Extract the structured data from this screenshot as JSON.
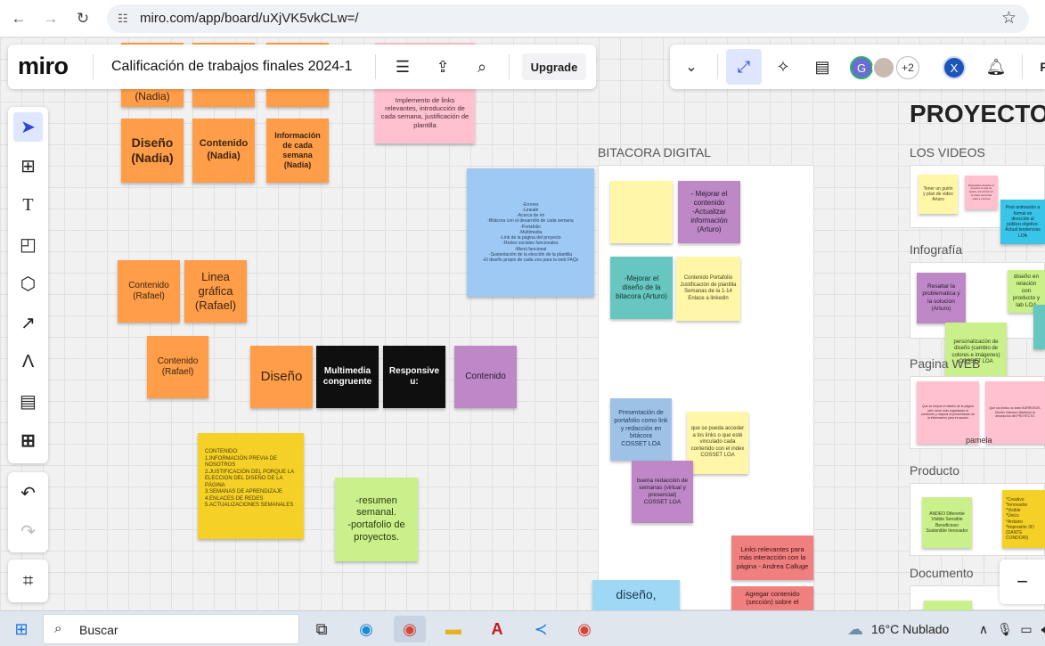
{
  "browser": {
    "url": "miro.com/app/board/uXjVK5vkCLw=/"
  },
  "app": {
    "logo": "miro",
    "board_title": "Calificación de trabajos finales 2024-1",
    "upgrade_label": "Upgrade",
    "collaborators": {
      "g_initial": "G",
      "more_count": "+2",
      "x_initial": "X"
    },
    "right_edge_text": "P"
  },
  "frames": {
    "bitacora_label": "BITACORA DIGITAL",
    "proyecto_title": "PROYECTO",
    "los_videos": "LOS VIDEOS",
    "infografia": "Infografía",
    "pagina_web": "Pagina WEB",
    "producto": "Producto",
    "documento": "Documento"
  },
  "notes": {
    "top_partial": "(Nadia)",
    "pink_top": "Implemento de links relevantes, introducción de cada semana, justificación de plantilla",
    "diseno_nadia": "Diseño (Nadia)",
    "contenido_nadia": "Contenido (Nadia)",
    "info_semana_nadia": "Información de cada semana (Nadia)",
    "blue_big": "-Errores\n-Linealtr\n-Acerca de mi\n-Bitácora con el desarrollo de cada semana\n-Portafolio\n-Multimedia\n-Link de la página del proyecto\n-Redes sociales funcionales\n-Menú funcional\n-Sustentación de la elección de la plantilla\n-El diseño propio de cada uno para la web FAQs",
    "contenido_rafael_1": "Contenido (Rafael)",
    "linea_grafica_rafael": "Linea gráfica (Rafael)",
    "contenido_rafael_2": "Contenido (Rafael)",
    "diseno": "Diseño",
    "multimedia": "Multimedia congruente",
    "responsive": "Responsive u:",
    "contenido": "Contenido",
    "yellow_contenido": "CONTENIDO:\n1.INFORMACIÓN PREVIA DE NOSOTROS\n2.JUSTIFICACIÓN DEL PORQUE LA ELECCION DEL DISEÑO DE LA PÁGINA\n3.SEMANAS DE APRENDIZAJE\n4.ENLACES DE REDES\n5.ACTUALIZACIONES SEMANALES",
    "resumen": "-resumen semanal.\n-portafolio de proyectos.",
    "bit_empty_yellow": "",
    "bit_mejorar_contenido": "- Mejorar el contenido\n-Actualizar información (Arturo)",
    "bit_mejorar_diseno": "-Mejorar el diseño de la bitacora (Arturo)",
    "bit_contenido_portafolio": "Contenido Portafolio Justificación de plantilla Semanas de la 1-14 Enlace a linkedin",
    "bit_presentacion": "Presentación de portafolio como link y redacción en bitácora\nCOSSET LOA",
    "bit_acceder_links": "que se pueda acceder a los links o que esté vinculado cada contenido con el index\nCOSSET LOA",
    "bit_buena_redaccion": "buena redacción de semanas (virtual y presencial)\nCOSSET LOA",
    "bit_links_relevantes": "Links relevantes para más interacción con la página - Andrea Calluge",
    "bit_agregar_contenido": "Agregar contenido (sección) sobre el",
    "diseno_bottom": "diseño,",
    "vid_tener_guion": "Tener un guión y plan de video\nArturo",
    "vid_pink_small": "Especificar durante el proceso lo que se quiere comunicar en el video de forma clara y concisa",
    "vid_blue": "Post animación a formal en dirección al público objetivo. Actual tendencias\nLOA",
    "inf_resaltar": "Resaltar la problematica y la solucion (Arturo)",
    "inf_diseno_relacion": "diseño en relación con producto y lab LOA",
    "inf_personalizacion": "personalización de diseño (cambio de colores e imágenes)\nCOSSET LOA",
    "web_pink_left": "Que se mejore el diseño de la página web, tener más organizado el contenido y mejorar la presentación de la información para el usuario",
    "web_pink_right": "Que los textos no sean BORROSOS. Diseño Inclusivo Mantener la descripción del PROYECTO.",
    "web_pamela": "pamela",
    "prod_lime": "ANDEO Diferente Visible Sensible Beneficioso Sostenible Innovador",
    "prod_yellow": "*Creativo\n*Innovador\n*Visible\n*Único\n*Arduino\n*Impresión 3D\n(DANTE CONDORI)"
  },
  "taskbar": {
    "search_label": "Buscar",
    "weather": "16°C  Nublado"
  }
}
